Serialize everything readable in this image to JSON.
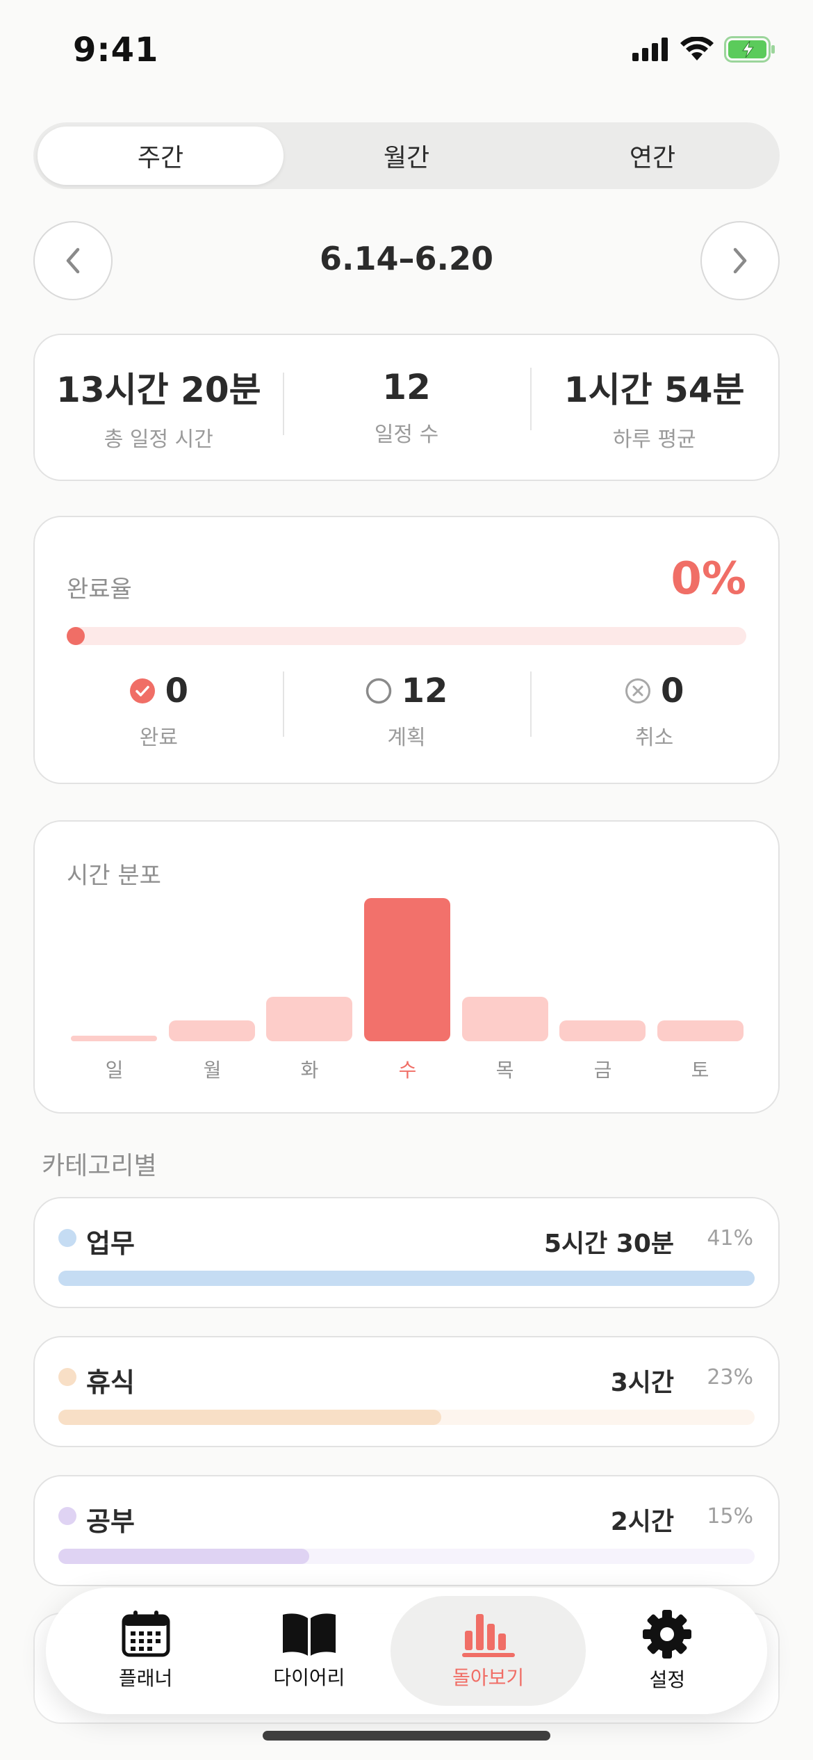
{
  "status_bar": {
    "time": "9:41"
  },
  "segmented": {
    "items": [
      "주간",
      "월간",
      "연간"
    ],
    "active_index": 0
  },
  "date_nav": {
    "range": "6.14–6.20"
  },
  "summary": [
    {
      "value": "13시간 20분",
      "label": "총 일정 시간"
    },
    {
      "value": "12",
      "label": "일정 수"
    },
    {
      "value": "1시간 54분",
      "label": "하루 평균"
    }
  ],
  "completion": {
    "title": "완료율",
    "percent_text": "0%",
    "percent": 0,
    "stats": [
      {
        "count": "0",
        "label": "완료",
        "icon": "check-circle-icon"
      },
      {
        "count": "12",
        "label": "계획",
        "icon": "empty-circle-icon"
      },
      {
        "count": "0",
        "label": "취소",
        "icon": "x-circle-icon"
      }
    ]
  },
  "distribution": {
    "title": "시간 분포",
    "highlight_index": 3
  },
  "chart_data": {
    "type": "bar",
    "categories": [
      "일",
      "월",
      "화",
      "수",
      "목",
      "금",
      "토"
    ],
    "values": [
      0.1,
      0.8,
      1.7,
      5.5,
      1.7,
      0.8,
      0.8
    ],
    "ylim": [
      0,
      5.5
    ],
    "grid": false
  },
  "categories_section": {
    "title": "카테고리별",
    "items": [
      {
        "name": "업무",
        "time": "5시간 30분",
        "percent_text": "41%",
        "fraction": 1.0,
        "color": "#C5DCF3",
        "track": "#EEF4FB"
      },
      {
        "name": "휴식",
        "time": "3시간",
        "percent_text": "23%",
        "fraction": 0.55,
        "color": "#F8DFC6",
        "track": "#FDF5EE"
      },
      {
        "name": "공부",
        "time": "2시간",
        "percent_text": "15%",
        "fraction": 0.36,
        "color": "#DFD3F3",
        "track": "#F6F3FC"
      }
    ]
  },
  "tab_bar": {
    "items": [
      {
        "label": "플래너",
        "icon": "calendar-icon"
      },
      {
        "label": "다이어리",
        "icon": "book-icon"
      },
      {
        "label": "돌아보기",
        "icon": "bar-chart-icon"
      },
      {
        "label": "설정",
        "icon": "gear-icon"
      }
    ],
    "active_index": 2
  },
  "colors": {
    "accent": "#F06E66",
    "accent_light": "#FDCDC9",
    "background": "#FAFAF9"
  }
}
